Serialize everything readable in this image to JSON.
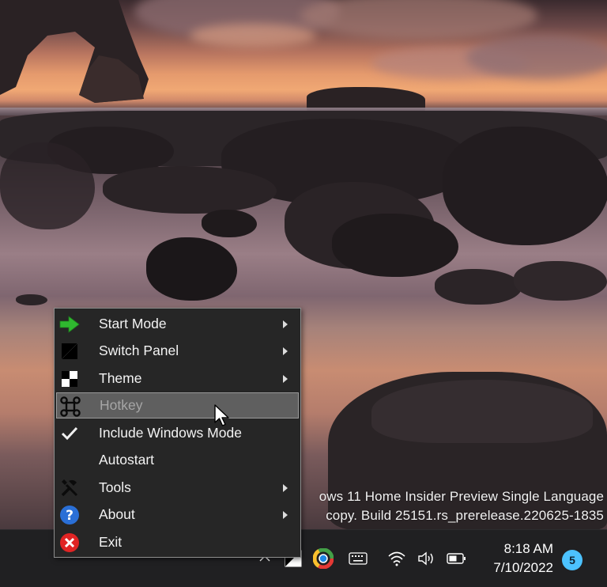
{
  "desktop": {
    "watermark_line1": "ows 11 Home Insider Preview Single Language",
    "watermark_line2": "copy. Build 25151.rs_prerelease.220625-1835"
  },
  "context_menu": {
    "items": [
      {
        "label": "Start Mode",
        "icon": "green-arrow-icon",
        "has_submenu": true
      },
      {
        "label": "Switch Panel",
        "icon": "switch-panel-icon",
        "has_submenu": true
      },
      {
        "label": "Theme",
        "icon": "theme-checker-icon",
        "has_submenu": true
      },
      {
        "label": "Hotkey",
        "icon": "command-key-icon",
        "has_submenu": false,
        "state": "disabled-highlighted"
      },
      {
        "label": "Include Windows Mode",
        "icon": "checkmark-icon",
        "has_submenu": false,
        "checked": true
      },
      {
        "label": "Autostart",
        "icon": "",
        "has_submenu": false
      },
      {
        "label": "Tools",
        "icon": "tools-icon",
        "has_submenu": true
      },
      {
        "label": "About",
        "icon": "help-icon",
        "has_submenu": true
      },
      {
        "label": "Exit",
        "icon": "exit-icon",
        "has_submenu": false
      }
    ],
    "colors": {
      "background": "#262626",
      "highlight": "#5f5f5f",
      "border": "#8e8e8e"
    }
  },
  "taskbar": {
    "tray_icons": [
      "chevron-up-icon",
      "easy-dark-mode-tray-icon",
      "browser-icon",
      "keyboard-icon",
      "wifi-icon",
      "volume-icon",
      "battery-icon"
    ],
    "time": "8:18 AM",
    "date": "7/10/2022",
    "notification_count": "5",
    "colors": {
      "background": "#202022",
      "badge": "#4cc2ff"
    }
  }
}
